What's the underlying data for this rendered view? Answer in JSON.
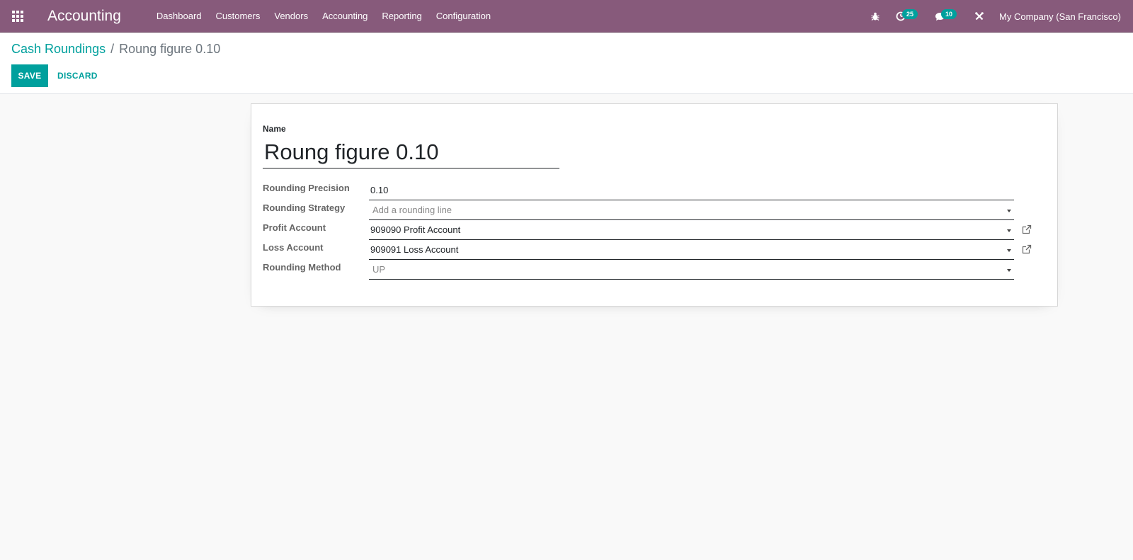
{
  "navbar": {
    "brand": "Accounting",
    "menu": [
      "Dashboard",
      "Customers",
      "Vendors",
      "Accounting",
      "Reporting",
      "Configuration"
    ],
    "activities_count": "25",
    "messages_count": "10",
    "company": "My Company (San Francisco)"
  },
  "breadcrumb": {
    "parent": "Cash Roundings",
    "separator": "/",
    "current": "Roung figure 0.10"
  },
  "buttons": {
    "save": "SAVE",
    "discard": "DISCARD"
  },
  "form": {
    "name_label": "Name",
    "name_value": "Roung figure 0.10",
    "fields": {
      "precision": {
        "label": "Rounding Precision",
        "value": "0.10"
      },
      "strategy": {
        "label": "Rounding Strategy",
        "placeholder": "Add a rounding line"
      },
      "profit": {
        "label": "Profit Account",
        "value": "909090 Profit Account"
      },
      "loss": {
        "label": "Loss Account",
        "value": "909091 Loss Account"
      },
      "method": {
        "label": "Rounding Method",
        "value": "UP"
      }
    }
  },
  "colors": {
    "navbar": "#875a7b",
    "accent": "#00a09d"
  }
}
